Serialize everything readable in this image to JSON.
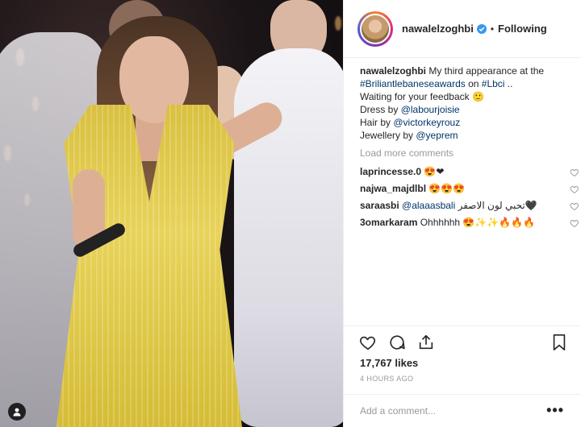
{
  "post": {
    "username": "nawalelzoghbi",
    "follow_status": "Following",
    "separator": "•",
    "caption": {
      "username": "nawalelzoghbi",
      "text1": " My third appearance at the ",
      "hashtag1": "#Briliantlebaneseawards",
      "text2": " on ",
      "hashtag2": "#Lbci",
      "text3": " ..",
      "line2": "Waiting for your feedback 🙂",
      "dress_prefix": "Dress by ",
      "dress_mention": "@labourjoisie",
      "hair_prefix": "Hair by ",
      "hair_mention": "@victorkeyrouz",
      "jewellery_prefix": "Jewellery by ",
      "jewellery_mention": "@yeprem"
    },
    "load_more_label": "Load more comments",
    "comments": [
      {
        "username": "laprincesse.0",
        "text": " 😍❤"
      },
      {
        "username": "najwa_majdlbl",
        "text": " 😍😍😍"
      },
      {
        "username": "saraasbi",
        "mention": " @alaaasbali",
        "text": " تحبي لون الاصفر🖤"
      },
      {
        "username": "3omarkaram",
        "text": " Ohhhhhh 😍✨✨🔥🔥🔥"
      }
    ],
    "likes": "17,767 likes",
    "timestamp": "4 HOURS AGO",
    "add_comment_placeholder": "Add a comment...",
    "more_label": "•••"
  },
  "icons": {
    "verified": "verified-badge-icon",
    "like": "heart-icon",
    "comment": "comment-icon",
    "share": "share-icon",
    "save": "bookmark-icon",
    "comment_like": "heart-outline-icon",
    "tagged": "person-tag-icon"
  },
  "colors": {
    "verified": "#3897f0",
    "link": "#003569",
    "muted": "#999999",
    "text": "#262626"
  }
}
